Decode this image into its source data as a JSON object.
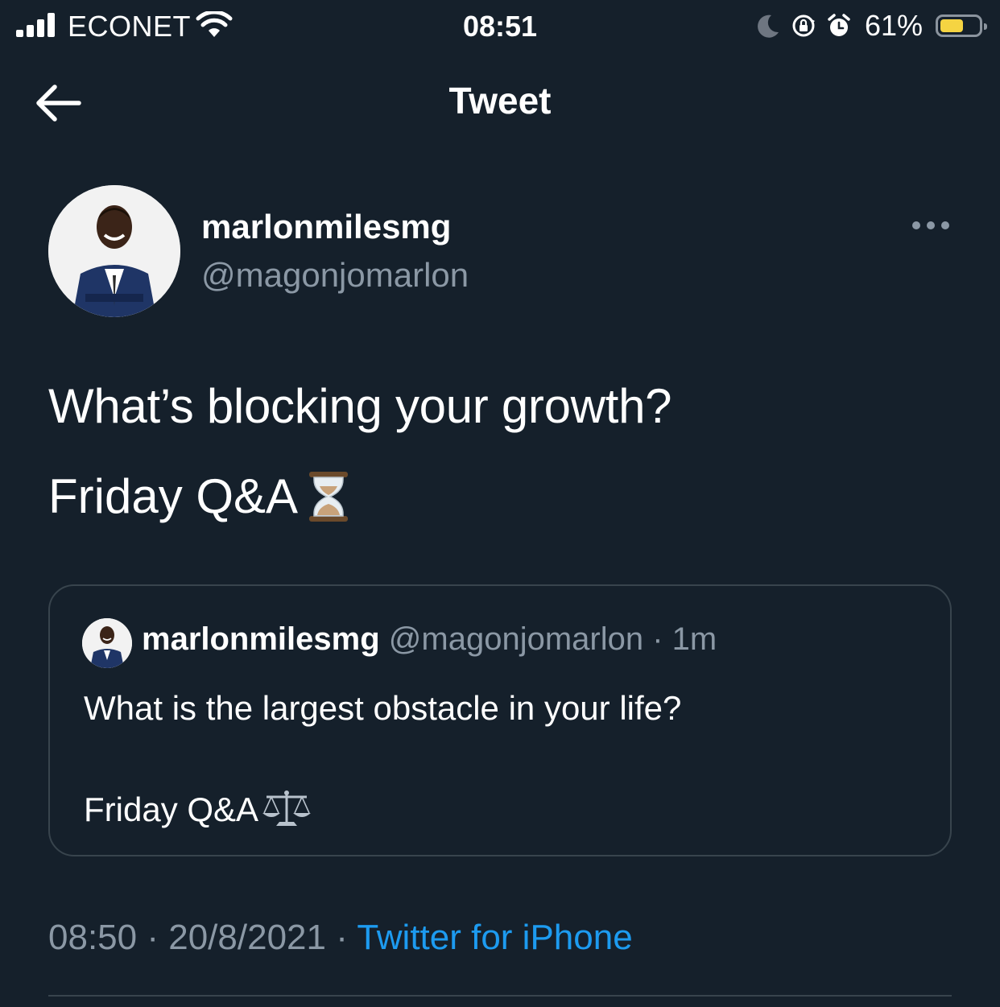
{
  "status_bar": {
    "carrier": "ECONET",
    "time": "08:51",
    "battery_percent": "61%",
    "battery_level": 0.61,
    "signal_bars": 4,
    "icons": [
      "signal-icon",
      "wifi-icon",
      "moon-icon",
      "rotation-lock-icon",
      "alarm-icon",
      "battery-icon"
    ],
    "battery_color": "#f5d442"
  },
  "nav": {
    "title": "Tweet",
    "back_icon": "arrow-left-icon"
  },
  "tweet": {
    "display_name": "marlonmilesmg",
    "handle": "@magonjomarlon",
    "text_line1": "What’s blocking your growth?",
    "text_line2": "Friday Q&A",
    "emoji_icon": "hourglass-icon",
    "more_icon": "more-dots-icon"
  },
  "quote": {
    "display_name": "marlonmilesmg",
    "handle": "@magonjomarlon",
    "separator": "·",
    "time": "1m",
    "text_line1": "What is the largest obstacle in your life?",
    "text_line2": "Friday Q&A",
    "emoji_icon": "scales-icon"
  },
  "meta": {
    "time": "08:50",
    "separator": "·",
    "date": "20/8/2021",
    "source": "Twitter for iPhone"
  },
  "colors": {
    "background": "#15202b",
    "text_primary": "#ffffff",
    "text_secondary": "#8b98a5",
    "link": "#1d9bf0",
    "border": "#38444d"
  }
}
